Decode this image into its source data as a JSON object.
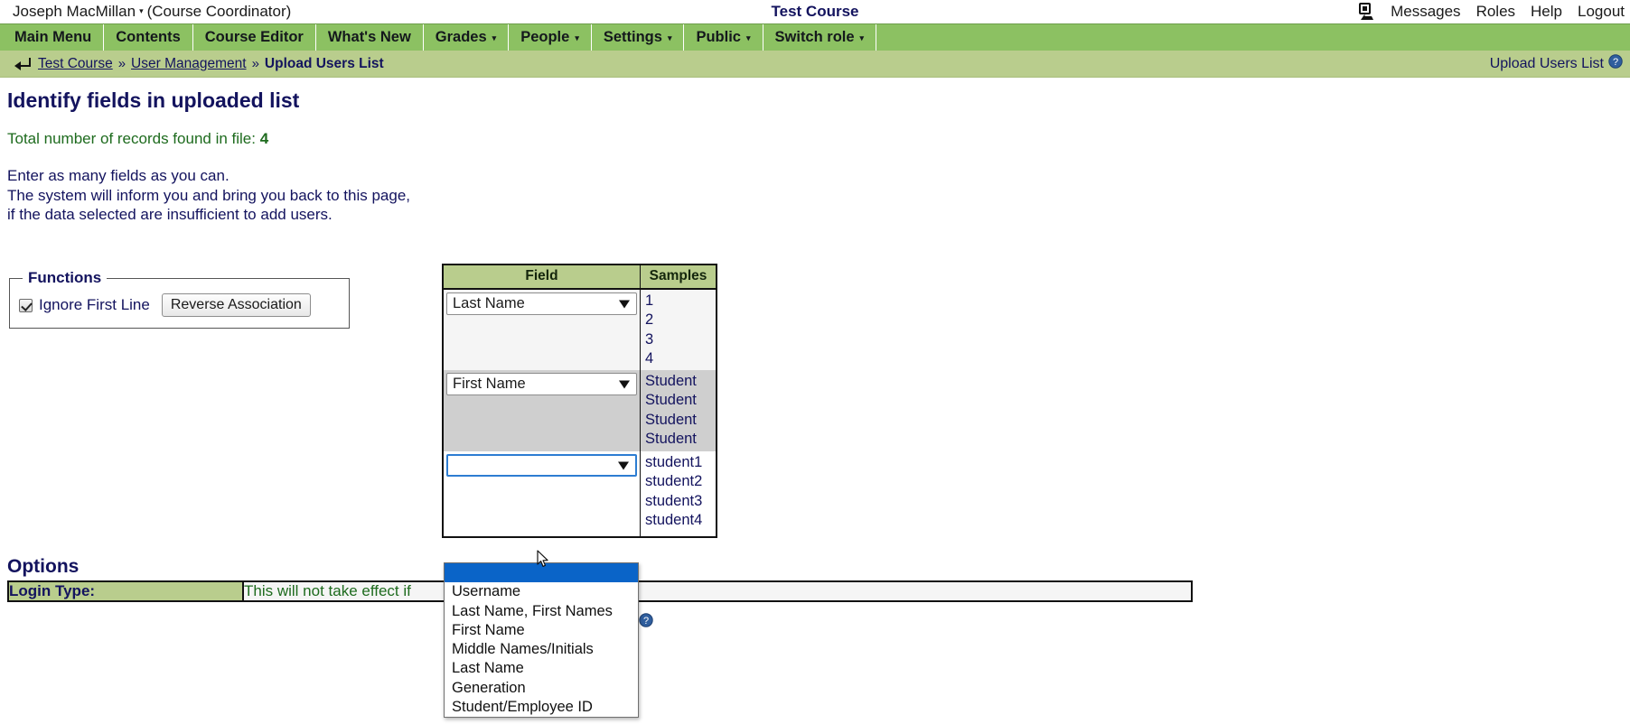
{
  "topbar": {
    "user_name": "Joseph MacMillan",
    "caret": "▾",
    "role": "(Course Coordinator)",
    "course_title": "Test Course",
    "links": [
      "Messages",
      "Roles",
      "Help",
      "Logout"
    ]
  },
  "nav": {
    "items": [
      {
        "label": "Main Menu",
        "has_caret": false
      },
      {
        "label": "Contents",
        "has_caret": false
      },
      {
        "label": "Course Editor",
        "has_caret": false
      },
      {
        "label": "What's New",
        "has_caret": false
      },
      {
        "label": "Grades",
        "has_caret": true
      },
      {
        "label": "People",
        "has_caret": true
      },
      {
        "label": "Settings",
        "has_caret": true
      },
      {
        "label": "Public",
        "has_caret": true
      },
      {
        "label": "Switch role",
        "has_caret": true
      }
    ],
    "caret": "▾"
  },
  "breadcrumb": {
    "items": [
      "Test Course",
      "User Management",
      "Upload Users List"
    ],
    "separator": "»",
    "right_label": "Upload Users List"
  },
  "page": {
    "heading": "Identify fields in uploaded list",
    "records_label": "Total number of records found in file:",
    "records_count": "4",
    "instruction_line1": "Enter as many fields as you can.",
    "instruction_line2": "The system will inform you and bring you back to this page,",
    "instruction_line3": "if the data selected are insufficient to add users."
  },
  "functions": {
    "legend": "Functions",
    "ignore_first_line_label": "Ignore First Line",
    "ignore_first_line_checked": true,
    "reverse_association_label": "Reverse Association"
  },
  "field_table": {
    "headers": [
      "Field",
      "Samples"
    ],
    "rows": [
      {
        "selected": "Last Name",
        "samples": [
          "1",
          "2",
          "3",
          "4"
        ]
      },
      {
        "selected": "First Name",
        "samples": [
          "Student",
          "Student",
          "Student",
          "Student"
        ]
      },
      {
        "selected": "",
        "samples": [
          "student1",
          "student2",
          "student3",
          "student4"
        ]
      }
    ]
  },
  "dropdown": {
    "open_for_row": 3,
    "options": [
      "",
      "Username",
      "Last Name, First Names",
      "First Name",
      "Middle Names/Initials",
      "Last Name",
      "Generation",
      "Student/Employee ID"
    ],
    "selected_index": 0
  },
  "options_section": {
    "heading": "Options",
    "login_type_label": "Login Type:",
    "login_type_note": "This will not take effect if"
  },
  "colors": {
    "nav_green": "#8cc162",
    "crumb_green": "#b9cd8d",
    "heading_navy": "#13135e",
    "records_green": "#1e6b1e",
    "highlight_blue": "#0a64c8"
  }
}
